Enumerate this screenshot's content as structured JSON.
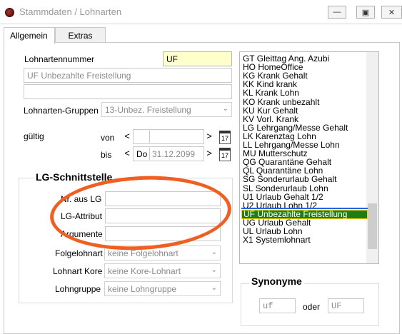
{
  "window": {
    "title": "Stammdaten / Lohnarten",
    "min_label": "—",
    "max_label": "▣",
    "close_label": "✕"
  },
  "tabs": [
    {
      "label": "Allgemein"
    },
    {
      "label": "Extras"
    }
  ],
  "form": {
    "lohnartennummer_label": "Lohnartennummer",
    "lohnartennummer_value": "UF",
    "bezeichnung_value": "UF Unbezahlte Freistellung",
    "zusatz_value": "",
    "gruppen_label": "Lohnarten-Gruppen",
    "gruppen_value": "13-Unbez. Freistellung",
    "gueltig_label": "gültig",
    "von_label": "von",
    "von_day": "",
    "von_date": "",
    "bis_label": "bis",
    "bis_day": "Do",
    "bis_date": "31.12.2099",
    "prev_glyph": "<",
    "next_glyph": ">",
    "cal_glyph": "17"
  },
  "lg": {
    "title": "LG-Schnittstelle",
    "nr_label": "Nr. aus LG",
    "nr_value": "",
    "attribut_label": "LG-Attribut",
    "attribut_value": "",
    "argumente_label": "Argumente",
    "argumente_value": "",
    "folge_label": "Folgelohnart",
    "folge_value": "keine Folgelohnart",
    "kore_label": "Lohnart Kore",
    "kore_value": "keine Kore-Lohnart",
    "gruppe_label": "Lohngruppe",
    "gruppe_value": "keine Lohngruppe"
  },
  "lohnarten_list": [
    "GT Gleittag Ang. Azubi",
    "HO HomeOffice",
    "KG Krank Gehalt",
    "KK Kind krank",
    "KL Krank Lohn",
    "KO Krank unbezahlt",
    "KU Kur Gehalt",
    "KV Vorl. Krank",
    "LG Lehrgang/Messe Gehalt",
    "LK Karenztag Lohn",
    "LL Lehrgang/Messe Lohn",
    "MU Mutterschutz",
    "QG Quarantäne Gehalt",
    "QL Quarantäne Lohn",
    "SG Sonderurlaub Gehalt",
    "SL Sonderurlaub Lohn",
    "U1 Urlaub Gehalt 1/2",
    "U2 Urlaub Lohn 1/2",
    "UF Unbezahlte Freistellung",
    "UG Urlaub Gehalt",
    "UL Urlaub Lohn",
    "X1 Systemlohnart"
  ],
  "selected_item": "UF Unbezahlte Freistellung",
  "synonyme": {
    "title": "Synonyme",
    "left_value": "uf",
    "oder_label": "oder",
    "right_value": "UF"
  },
  "colors": {
    "selection": "#1a7f1a",
    "annotation": "#f05f22",
    "highlight_field": "#ffffcc"
  },
  "combo_arrow": "⌄"
}
